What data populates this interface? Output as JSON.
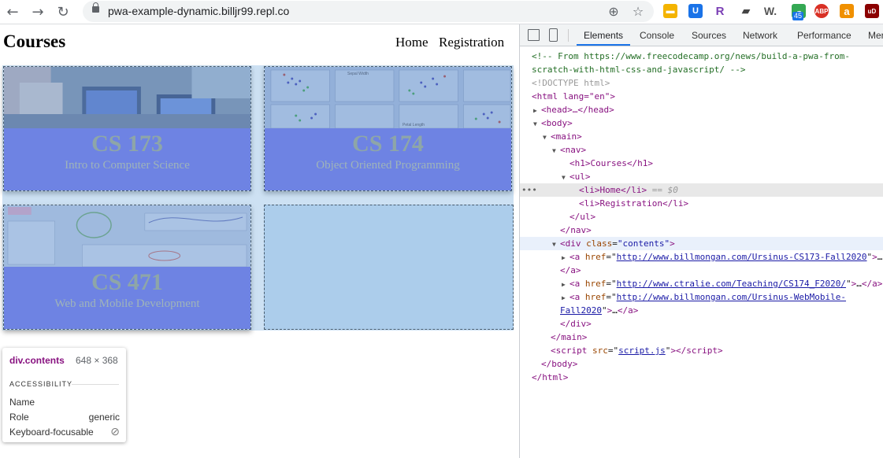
{
  "browser": {
    "url": "pwa-example-dynamic.billjr99.repl.co",
    "ext_badge": "45",
    "ext_letters": [
      "R",
      "W.",
      "ABP",
      "a",
      "uD"
    ]
  },
  "page": {
    "heading": "Courses",
    "menu": [
      "Home",
      "Registration"
    ],
    "cards": [
      {
        "code": "CS 173",
        "title": "Intro to Computer Science"
      },
      {
        "code": "CS 174",
        "title": "Object Oriented Programming"
      },
      {
        "code": "CS 471",
        "title": "Web and Mobile Development"
      }
    ],
    "thumb_labels": [
      "Sepal Width",
      "Petal Length"
    ]
  },
  "tooltip": {
    "element": "div.contents",
    "size": "648 × 368",
    "section": "ACCESSIBILITY",
    "rows": [
      {
        "label": "Name",
        "value": ""
      },
      {
        "label": "Role",
        "value": "generic"
      },
      {
        "label": "Keyboard-focusable",
        "value": "⊘"
      }
    ]
  },
  "devtools": {
    "tabs": [
      "Elements",
      "Console",
      "Sources",
      "Network",
      "Performance",
      "Mer"
    ],
    "active_tab": "Elements",
    "comment_line1": "<!-- From https://www.freecodecamp.org/news/build-a-pwa-from-",
    "comment_line2": "scratch-with-html-css-and-javascript/ -->",
    "doctype": "<!DOCTYPE html>",
    "html_open": "<html lang=\"en\">",
    "head": "<head>…</head>",
    "body_open": "<body>",
    "main_open": "<main>",
    "nav_open": "<nav>",
    "h1": "<h1>Courses</h1>",
    "ul_open": "<ul>",
    "li_home": "<li>Home</li>",
    "li_home_suffix": "== $0",
    "li_reg": "<li>Registration</li>",
    "ul_close": "</ul>",
    "nav_close": "</nav>",
    "div_tag": "div",
    "div_attr": "class",
    "div_val": "\"contents\"",
    "links": [
      "http://www.billmongan.com/Ursinus-CS173-Fall2020",
      "http://www.ctralie.com/Teaching/CS174_F2020/",
      "http://www.billmongan.com/Ursinus-WebMobile-",
      "Fall2020"
    ],
    "a_close": "</a>",
    "div_close": "</div>",
    "main_close": "</main>",
    "script_src": "script.js",
    "body_close": "</body>",
    "html_close": "</html>"
  }
}
